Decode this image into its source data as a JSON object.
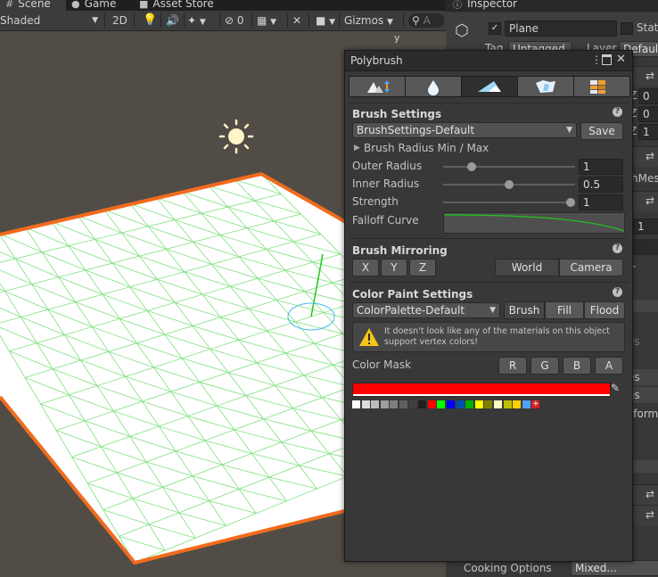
{
  "tabs": [
    {
      "label": "Scene",
      "icon": "hash-icon"
    },
    {
      "label": "Game",
      "icon": "gamepad-icon"
    },
    {
      "label": "Asset Store",
      "icon": "store-icon"
    }
  ],
  "scene_toolbar": {
    "shading_mode": "Shaded",
    "toggle_2d": "2D",
    "hidden_count": "0",
    "gizmos_label": "Gizmos",
    "search_placeholder": "A"
  },
  "gizmo_axis": "y",
  "inspector": {
    "tab_label": "Inspector",
    "object_name": "Plane",
    "static_label": "Stat",
    "tag_label": "Tag",
    "tag_value": "Untagged",
    "layer_label": "Layer",
    "layer_value": "Default",
    "axis_z1": "Z",
    "val_z1": "0",
    "axis_z2": "Z",
    "val_z2": "0",
    "axis_z3": "Z",
    "val_z3": "1",
    "mesh_fragment": "hMes",
    "value_1": "1",
    "frag_es1": "es",
    "frag_es2": "es",
    "frag_es3": "es",
    "frag_sform": "sform",
    "cooking_label": "Cooking Options",
    "cooking_value": "Mixed..."
  },
  "polybrush": {
    "title": "Polybrush",
    "brush_settings": {
      "title": "Brush Settings",
      "preset": "BrushSettings-Default",
      "save_label": "Save",
      "radius_foldout": "Brush Radius Min / Max",
      "outer_radius_label": "Outer Radius",
      "outer_radius_value": "1",
      "inner_radius_label": "Inner Radius",
      "inner_radius_value": "0.5",
      "strength_label": "Strength",
      "strength_value": "1",
      "falloff_label": "Falloff Curve"
    },
    "mirroring": {
      "title": "Brush Mirroring",
      "x": "X",
      "y": "Y",
      "z": "Z",
      "world": "World",
      "camera": "Camera"
    },
    "color_paint": {
      "title": "Color Paint Settings",
      "palette": "ColorPalette-Default",
      "brush": "Brush",
      "fill": "Fill",
      "flood": "Flood",
      "warning": "It doesn't look like any of the materials on this object support vertex colors!",
      "color_mask_label": "Color Mask",
      "mask_r": "R",
      "mask_g": "G",
      "mask_b": "B",
      "mask_a": "A",
      "current_color": "#ff0000",
      "palette_colors": [
        "#ffffff",
        "#dcdcdc",
        "#bdbdbd",
        "#9e9e9e",
        "#7f7f7f",
        "#5f5f5f",
        "#3f3f3f",
        "#1f1f1f",
        "#ff0000",
        "#00ff00",
        "#0000ff",
        "#0050b0",
        "#00b000",
        "#ffff00",
        "#808000",
        "#ffffc0",
        "#c0c000",
        "#ffd000",
        "#50a0ff",
        "#ffffff"
      ]
    }
  },
  "colors": {
    "selection_outline": "#f26b1d",
    "wireframe": "#7fe07f",
    "falloff_curve": "#1ec81e"
  }
}
